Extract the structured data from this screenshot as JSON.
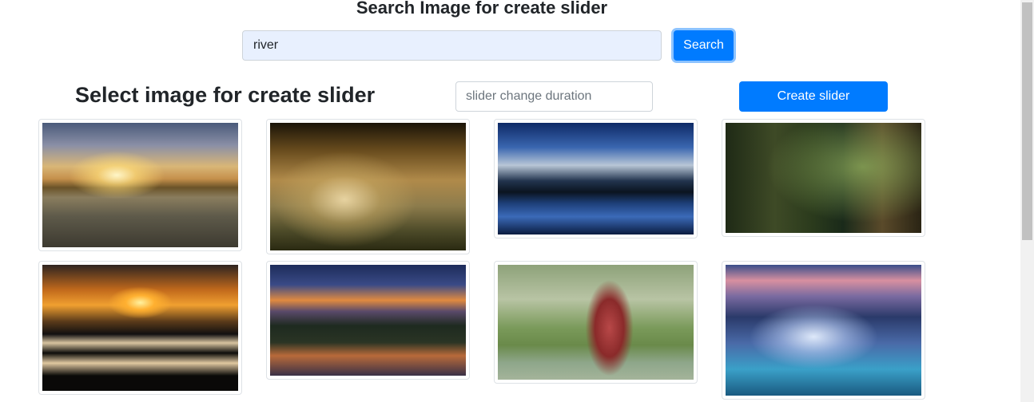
{
  "header": {
    "title": "Search Image for create slider"
  },
  "search": {
    "value": "river",
    "button_label": "Search"
  },
  "gallery": {
    "title": "Select image for create slider",
    "duration_placeholder": "slider change duration",
    "create_button_label": "Create slider",
    "images": [
      {
        "subject": "autumn river at sunset"
      },
      {
        "subject": "boat in misty sunbeams"
      },
      {
        "subject": "snowy mountain lake reflection"
      },
      {
        "subject": "green canyon cliffs"
      },
      {
        "subject": "winding river at sunrise"
      },
      {
        "subject": "mountain river at dusk"
      },
      {
        "subject": "woman in red dress in water"
      },
      {
        "subject": "waterfall at twilight"
      }
    ]
  },
  "colors": {
    "primary": "#007bff",
    "autofill_bg": "#e8f0fe"
  }
}
